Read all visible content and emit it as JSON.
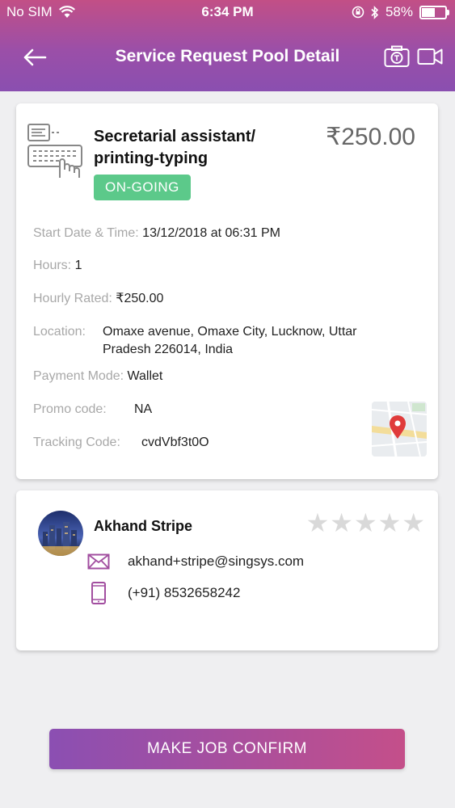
{
  "status_bar": {
    "carrier": "No SIM",
    "time": "6:34 PM",
    "battery": "58%"
  },
  "header": {
    "title": "Service Request Pool Detail"
  },
  "service": {
    "title": "Secretarial assistant/ printing-typing",
    "price": "₹250.00",
    "status": "ON-GOING",
    "status_color": "#5cc98a"
  },
  "details": {
    "start_label": "Start Date & Time:",
    "start_value": "13/12/2018 at 06:31 PM",
    "hours_label": "Hours:",
    "hours_value": "1",
    "rate_label": "Hourly Rated:",
    "rate_value": "₹250.00",
    "location_label": "Location:",
    "location_value": "Omaxe avenue, Omaxe City, Lucknow, Uttar Pradesh 226014, India",
    "payment_label": "Payment Mode:",
    "payment_value": "Wallet",
    "promo_label": "Promo code:",
    "promo_value": "NA",
    "tracking_label": "Tracking Code:",
    "tracking_value": "cvdVbf3t0O"
  },
  "provider": {
    "name": "Akhand Stripe",
    "email": "akhand+stripe@singsys.com",
    "phone": "(+91) 8532658242",
    "rating_stars": 5,
    "rating_filled": 0
  },
  "cta": {
    "label": "MAKE JOB CONFIRM"
  },
  "colors": {
    "accent_purple": "#8a4fb0",
    "accent_pink": "#c44f8a",
    "status_green": "#5cc98a"
  }
}
